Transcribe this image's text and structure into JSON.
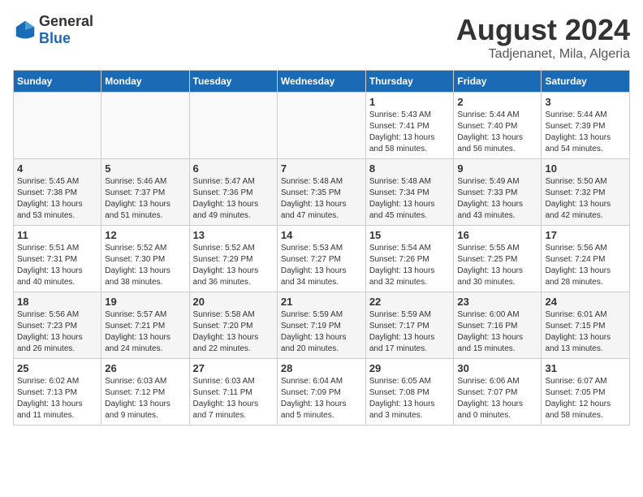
{
  "header": {
    "logo_general": "General",
    "logo_blue": "Blue",
    "month_year": "August 2024",
    "location": "Tadjenanet, Mila, Algeria"
  },
  "columns": [
    "Sunday",
    "Monday",
    "Tuesday",
    "Wednesday",
    "Thursday",
    "Friday",
    "Saturday"
  ],
  "weeks": [
    [
      {
        "day": "",
        "info": ""
      },
      {
        "day": "",
        "info": ""
      },
      {
        "day": "",
        "info": ""
      },
      {
        "day": "",
        "info": ""
      },
      {
        "day": "1",
        "info": "Sunrise: 5:43 AM\nSunset: 7:41 PM\nDaylight: 13 hours\nand 58 minutes."
      },
      {
        "day": "2",
        "info": "Sunrise: 5:44 AM\nSunset: 7:40 PM\nDaylight: 13 hours\nand 56 minutes."
      },
      {
        "day": "3",
        "info": "Sunrise: 5:44 AM\nSunset: 7:39 PM\nDaylight: 13 hours\nand 54 minutes."
      }
    ],
    [
      {
        "day": "4",
        "info": "Sunrise: 5:45 AM\nSunset: 7:38 PM\nDaylight: 13 hours\nand 53 minutes."
      },
      {
        "day": "5",
        "info": "Sunrise: 5:46 AM\nSunset: 7:37 PM\nDaylight: 13 hours\nand 51 minutes."
      },
      {
        "day": "6",
        "info": "Sunrise: 5:47 AM\nSunset: 7:36 PM\nDaylight: 13 hours\nand 49 minutes."
      },
      {
        "day": "7",
        "info": "Sunrise: 5:48 AM\nSunset: 7:35 PM\nDaylight: 13 hours\nand 47 minutes."
      },
      {
        "day": "8",
        "info": "Sunrise: 5:48 AM\nSunset: 7:34 PM\nDaylight: 13 hours\nand 45 minutes."
      },
      {
        "day": "9",
        "info": "Sunrise: 5:49 AM\nSunset: 7:33 PM\nDaylight: 13 hours\nand 43 minutes."
      },
      {
        "day": "10",
        "info": "Sunrise: 5:50 AM\nSunset: 7:32 PM\nDaylight: 13 hours\nand 42 minutes."
      }
    ],
    [
      {
        "day": "11",
        "info": "Sunrise: 5:51 AM\nSunset: 7:31 PM\nDaylight: 13 hours\nand 40 minutes."
      },
      {
        "day": "12",
        "info": "Sunrise: 5:52 AM\nSunset: 7:30 PM\nDaylight: 13 hours\nand 38 minutes."
      },
      {
        "day": "13",
        "info": "Sunrise: 5:52 AM\nSunset: 7:29 PM\nDaylight: 13 hours\nand 36 minutes."
      },
      {
        "day": "14",
        "info": "Sunrise: 5:53 AM\nSunset: 7:27 PM\nDaylight: 13 hours\nand 34 minutes."
      },
      {
        "day": "15",
        "info": "Sunrise: 5:54 AM\nSunset: 7:26 PM\nDaylight: 13 hours\nand 32 minutes."
      },
      {
        "day": "16",
        "info": "Sunrise: 5:55 AM\nSunset: 7:25 PM\nDaylight: 13 hours\nand 30 minutes."
      },
      {
        "day": "17",
        "info": "Sunrise: 5:56 AM\nSunset: 7:24 PM\nDaylight: 13 hours\nand 28 minutes."
      }
    ],
    [
      {
        "day": "18",
        "info": "Sunrise: 5:56 AM\nSunset: 7:23 PM\nDaylight: 13 hours\nand 26 minutes."
      },
      {
        "day": "19",
        "info": "Sunrise: 5:57 AM\nSunset: 7:21 PM\nDaylight: 13 hours\nand 24 minutes."
      },
      {
        "day": "20",
        "info": "Sunrise: 5:58 AM\nSunset: 7:20 PM\nDaylight: 13 hours\nand 22 minutes."
      },
      {
        "day": "21",
        "info": "Sunrise: 5:59 AM\nSunset: 7:19 PM\nDaylight: 13 hours\nand 20 minutes."
      },
      {
        "day": "22",
        "info": "Sunrise: 5:59 AM\nSunset: 7:17 PM\nDaylight: 13 hours\nand 17 minutes."
      },
      {
        "day": "23",
        "info": "Sunrise: 6:00 AM\nSunset: 7:16 PM\nDaylight: 13 hours\nand 15 minutes."
      },
      {
        "day": "24",
        "info": "Sunrise: 6:01 AM\nSunset: 7:15 PM\nDaylight: 13 hours\nand 13 minutes."
      }
    ],
    [
      {
        "day": "25",
        "info": "Sunrise: 6:02 AM\nSunset: 7:13 PM\nDaylight: 13 hours\nand 11 minutes."
      },
      {
        "day": "26",
        "info": "Sunrise: 6:03 AM\nSunset: 7:12 PM\nDaylight: 13 hours\nand 9 minutes."
      },
      {
        "day": "27",
        "info": "Sunrise: 6:03 AM\nSunset: 7:11 PM\nDaylight: 13 hours\nand 7 minutes."
      },
      {
        "day": "28",
        "info": "Sunrise: 6:04 AM\nSunset: 7:09 PM\nDaylight: 13 hours\nand 5 minutes."
      },
      {
        "day": "29",
        "info": "Sunrise: 6:05 AM\nSunset: 7:08 PM\nDaylight: 13 hours\nand 3 minutes."
      },
      {
        "day": "30",
        "info": "Sunrise: 6:06 AM\nSunset: 7:07 PM\nDaylight: 13 hours\nand 0 minutes."
      },
      {
        "day": "31",
        "info": "Sunrise: 6:07 AM\nSunset: 7:05 PM\nDaylight: 12 hours\nand 58 minutes."
      }
    ]
  ]
}
